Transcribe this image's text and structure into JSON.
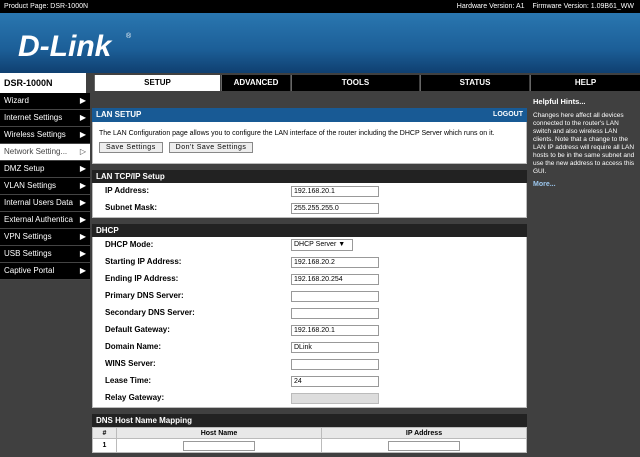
{
  "topbar": {
    "product": "Product Page: DSR-1000N",
    "hardware": "Hardware Version: A1",
    "firmware": "Firmware Version: 1.09B61_WW"
  },
  "brand": {
    "logo": "D-Link",
    "reg": "®"
  },
  "model": "DSR-1000N",
  "tabs": [
    {
      "label": "SETUP"
    },
    {
      "label": "ADVANCED"
    },
    {
      "label": "TOOLS"
    },
    {
      "label": "STATUS"
    },
    {
      "label": "HELP"
    }
  ],
  "sidebar": {
    "items": [
      {
        "label": "Wizard"
      },
      {
        "label": "Internet Settings"
      },
      {
        "label": "Wireless Settings"
      },
      {
        "label": "Network Setting..."
      },
      {
        "label": "DMZ Setup"
      },
      {
        "label": "VLAN Settings"
      },
      {
        "label": "Internal Users Data"
      },
      {
        "label": "External Authentica"
      },
      {
        "label": "VPN Settings"
      },
      {
        "label": "USB Settings"
      },
      {
        "label": "Captive Portal"
      }
    ],
    "arrow": "▶",
    "arrow_active": "▷"
  },
  "lan_setup": {
    "title": "LAN SETUP",
    "logout": "LOGOUT",
    "description": "The LAN Configuration page allows you to configure the LAN interface of the router including the DHCP Server which runs on it.",
    "save_label": "Save Settings",
    "dont_save_label": "Don't Save Settings"
  },
  "tcpip": {
    "title": "LAN TCP/IP Setup",
    "ip_label": "IP Address:",
    "ip_value": "192.168.20.1",
    "mask_label": "Subnet Mask:",
    "mask_value": "255.255.255.0"
  },
  "dhcp": {
    "title": "DHCP",
    "fields": [
      {
        "label": "DHCP Mode:",
        "value": "DHCP Server ▼",
        "kind": "select"
      },
      {
        "label": "Starting IP Address:",
        "value": "192.168.20.2",
        "kind": "input"
      },
      {
        "label": "Ending IP Address:",
        "value": "192.168.20.254",
        "kind": "input"
      },
      {
        "label": "Primary DNS Server:",
        "value": "",
        "kind": "input"
      },
      {
        "label": "Secondary DNS Server:",
        "value": "",
        "kind": "input"
      },
      {
        "label": "Default Gateway:",
        "value": "192.168.20.1",
        "kind": "input"
      },
      {
        "label": "Domain Name:",
        "value": "DLink",
        "kind": "input"
      },
      {
        "label": "WINS Server:",
        "value": "",
        "kind": "input"
      },
      {
        "label": "Lease Time:",
        "value": "24",
        "kind": "input"
      },
      {
        "label": "Relay Gateway:",
        "value": "",
        "kind": "disabled"
      }
    ]
  },
  "dns_map": {
    "title": "DNS Host Name Mapping",
    "headers": [
      "#",
      "Host Name",
      "IP Address"
    ],
    "rows": [
      {
        "num": "1"
      }
    ]
  },
  "hints": {
    "title": "Helpful Hints...",
    "body": "Changes here affect all devices connected to the router's LAN switch and also wireless LAN clients. Note that a change to the LAN IP address will require all LAN hosts to be in the same subnet and use the new address to access this GUI.",
    "more": "More..."
  }
}
